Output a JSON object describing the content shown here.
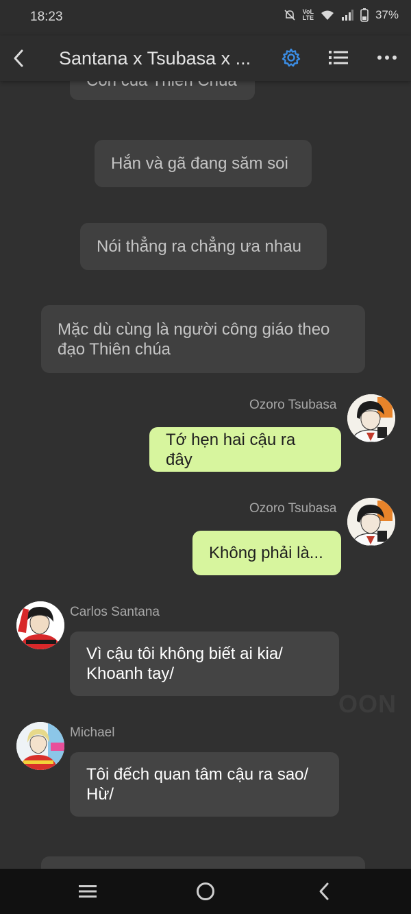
{
  "status_bar": {
    "time": "18:23",
    "battery": "37%",
    "icons": [
      "mute-icon",
      "volte-icon",
      "wifi-icon",
      "signal-icon",
      "battery-icon"
    ]
  },
  "header": {
    "title": "Santana x Tsubasa x ...",
    "icons": [
      "back-arrow-icon",
      "gear-icon",
      "list-icon",
      "more-icon"
    ],
    "accent_color": "#3b8ee6"
  },
  "messages": {
    "narration_top_partial": "Con của Thiên Chúa",
    "narration_1": "Hắn và gã đang săm soi",
    "narration_2": "Nói thẳng ra chẳng ưa nhau",
    "narration_3_line1": "Mặc dù cùng là người công giáo theo",
    "narration_3_line2": "đạo Thiên chúa",
    "tsubasa_1": {
      "sender": "Ozoro Tsubasa",
      "text": "Tớ hẹn hai cậu ra đây"
    },
    "tsubasa_2": {
      "sender": "Ozoro Tsubasa",
      "text": "Không phải là..."
    },
    "santana": {
      "sender": "Carlos Santana",
      "line1": "Vì cậu tôi không biết ai kia/",
      "line2": "Khoanh tay/"
    },
    "michael": {
      "sender": "Michael",
      "line1": "Tôi đếch quan tâm cậu ra sao/",
      "line2": "Hừ/"
    }
  },
  "watermark": "OON",
  "colors": {
    "background": "#303030",
    "mine_bubble": "#d7f59e",
    "other_bubble": "#444444",
    "narration_bubble": "#404040"
  },
  "nav_bar": {
    "icons": [
      "menu-icon",
      "home-icon",
      "back-icon"
    ]
  }
}
